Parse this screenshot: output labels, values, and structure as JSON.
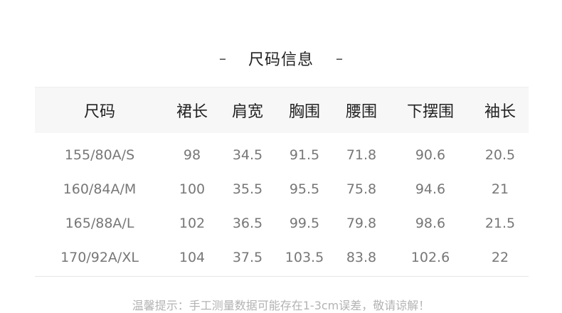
{
  "title": {
    "left_dash": "–",
    "text": "尺码信息",
    "right_dash": "–"
  },
  "table": {
    "headers": [
      "尺码",
      "裙长",
      "肩宽",
      "胸围",
      "腰围",
      "下摆围",
      "袖长"
    ],
    "rows": [
      [
        "155/80A/S",
        "98",
        "34.5",
        "91.5",
        "71.8",
        "90.6",
        "20.5"
      ],
      [
        "160/84A/M",
        "100",
        "35.5",
        "95.5",
        "75.8",
        "94.6",
        "21"
      ],
      [
        "165/88A/L",
        "102",
        "36.5",
        "99.5",
        "79.8",
        "98.6",
        "21.5"
      ],
      [
        "170/92A/XL",
        "104",
        "37.5",
        "103.5",
        "83.8",
        "102.6",
        "22"
      ]
    ]
  },
  "note": "温馨提示：手工测量数据可能存在1-3cm误差，敬请谅解！",
  "colors": {
    "header_background": "#f7f7f7",
    "header_text": "#222222",
    "cell_text": "#777777",
    "note_text": "#b3b3b3"
  }
}
